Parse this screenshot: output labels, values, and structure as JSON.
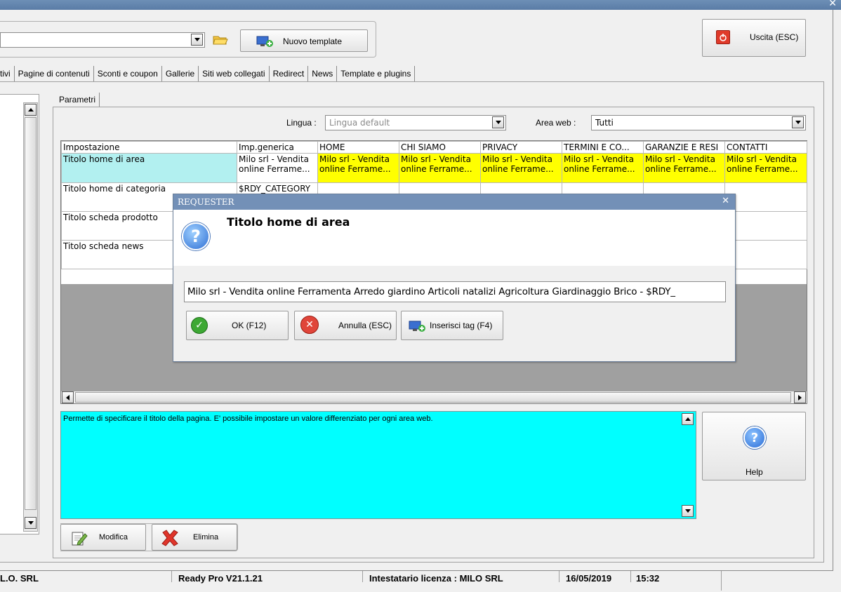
{
  "toolbar": {
    "new_template_label": "Nuovo template",
    "exit_label": "Uscita (ESC)"
  },
  "tabs": [
    {
      "label": "tivi"
    },
    {
      "label": "Pagine di contenuti"
    },
    {
      "label": "Sconti e coupon"
    },
    {
      "label": "Gallerie"
    },
    {
      "label": "Siti web collegati"
    },
    {
      "label": "Redirect"
    },
    {
      "label": "News"
    },
    {
      "label": "Template e plugins"
    }
  ],
  "params": {
    "tab_label": "Parametri",
    "lingua_label": "Lingua :",
    "lingua_value": "Lingua default",
    "area_label": "Area web :",
    "area_value": "Tutti"
  },
  "grid": {
    "headers": [
      "Impostazione",
      "Imp.generica",
      "HOME",
      "CHI SIAMO",
      "PRIVACY",
      "TERMINI E CO...",
      "GARANZIE E RESI",
      "CONTATTI"
    ],
    "rows": [
      {
        "name": "Titolo home di area",
        "cells": [
          "Milo srl - Vendita online Ferrame...",
          "Milo srl - Vendita online Ferrame...",
          "Milo srl - Vendita online Ferrame...",
          "Milo srl - Vendita online Ferrame...",
          "Milo srl - Vendita online Ferrame...",
          "Milo srl - Vendita online Ferrame...",
          "Milo srl - Vendita online Ferrame..."
        ]
      },
      {
        "name": "Titolo home di categoria",
        "cells": [
          "$RDY_CATEGORY",
          "",
          "",
          "",
          "",
          "",
          ""
        ]
      },
      {
        "name": "Titolo scheda prodotto",
        "cells": [
          "",
          "",
          "",
          "",
          "",
          "",
          ""
        ]
      },
      {
        "name": "Titolo scheda news",
        "cells": [
          "",
          "",
          "",
          "",
          "",
          "",
          ""
        ]
      }
    ]
  },
  "description": {
    "text": "Permette di specificare il titolo della pagina. E' possibile impostare un valore differenziato per ogni area web."
  },
  "help": {
    "label": "Help"
  },
  "actions": {
    "edit_label": "Modifica",
    "delete_label": "Elimina"
  },
  "dialog": {
    "title": "REQUESTER",
    "heading": "Titolo home di area",
    "input_value": "Milo srl - Vendita online Ferramenta Arredo giardino Articoli natalizi Agricoltura Giardinaggio Brico - $RDY_",
    "ok_label": "OK (F12)",
    "cancel_label": "Annulla (ESC)",
    "insert_tag_label": "Inserisci tag (F4)"
  },
  "statusbar": {
    "company": "L.O. SRL",
    "version": "Ready Pro V21.1.21",
    "license": "Intestatario licenza : MILO SRL",
    "date": "16/05/2019",
    "time": "15:32"
  },
  "colors": {
    "titlebar": "#5a7ca6",
    "highlight_yellow": "#ffff00",
    "selected_cell": "#b2f0f0",
    "description_bg": "#00ffff"
  }
}
